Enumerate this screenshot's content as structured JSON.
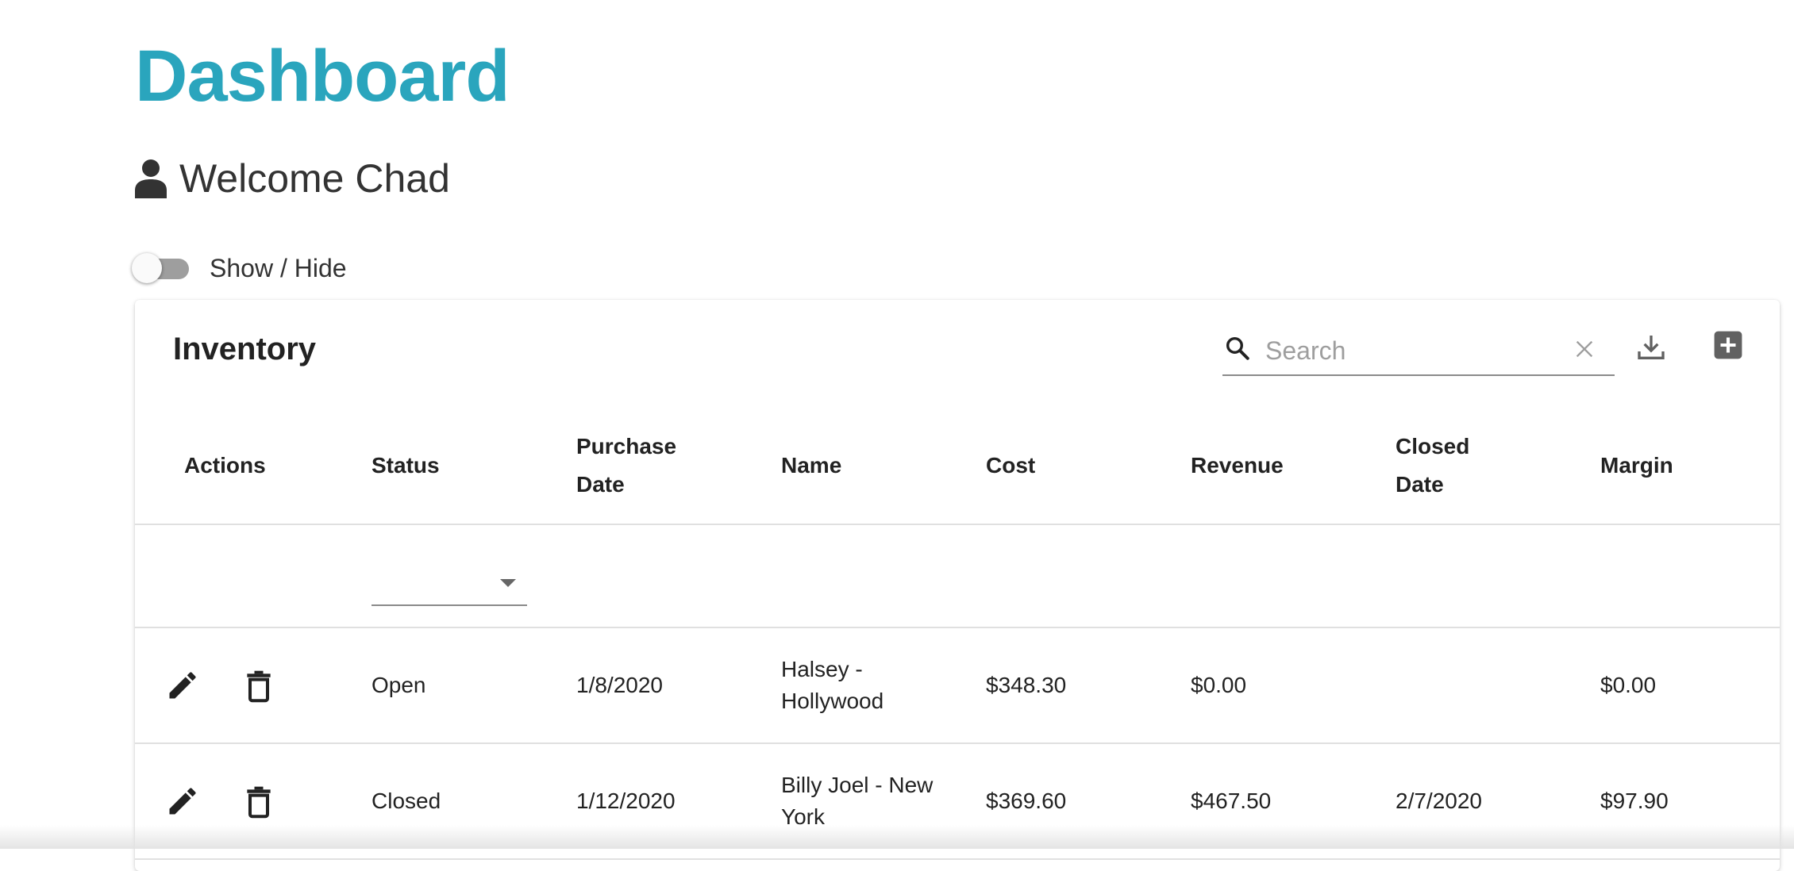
{
  "page": {
    "title": "Dashboard",
    "welcome": "Welcome Chad"
  },
  "toggle": {
    "label": "Show / Hide",
    "on": false
  },
  "inventory": {
    "title": "Inventory",
    "search": {
      "placeholder": "Search",
      "value": ""
    },
    "columns": [
      "Actions",
      "Status",
      "Purchase Date",
      "Name",
      "Cost",
      "Revenue",
      "Closed Date",
      "Margin"
    ],
    "status_filter": "",
    "rows": [
      {
        "status": "Open",
        "purchase_date": "1/8/2020",
        "name": "Halsey - Hollywood",
        "cost": "$348.30",
        "revenue": "$0.00",
        "closed_date": "",
        "margin": "$0.00"
      },
      {
        "status": "Closed",
        "purchase_date": "1/12/2020",
        "name": "Billy Joel - New York",
        "cost": "$369.60",
        "revenue": "$467.50",
        "closed_date": "2/7/2020",
        "margin": "$97.90"
      }
    ]
  },
  "colors": {
    "title": "#2aa5bd",
    "text": "#222222",
    "divider": "#e0e0e0",
    "icon": "#616161"
  },
  "icons": [
    "user-icon",
    "search-icon",
    "close-icon",
    "download-icon",
    "add-box-icon",
    "edit-icon",
    "delete-icon",
    "chevron-down-icon"
  ]
}
